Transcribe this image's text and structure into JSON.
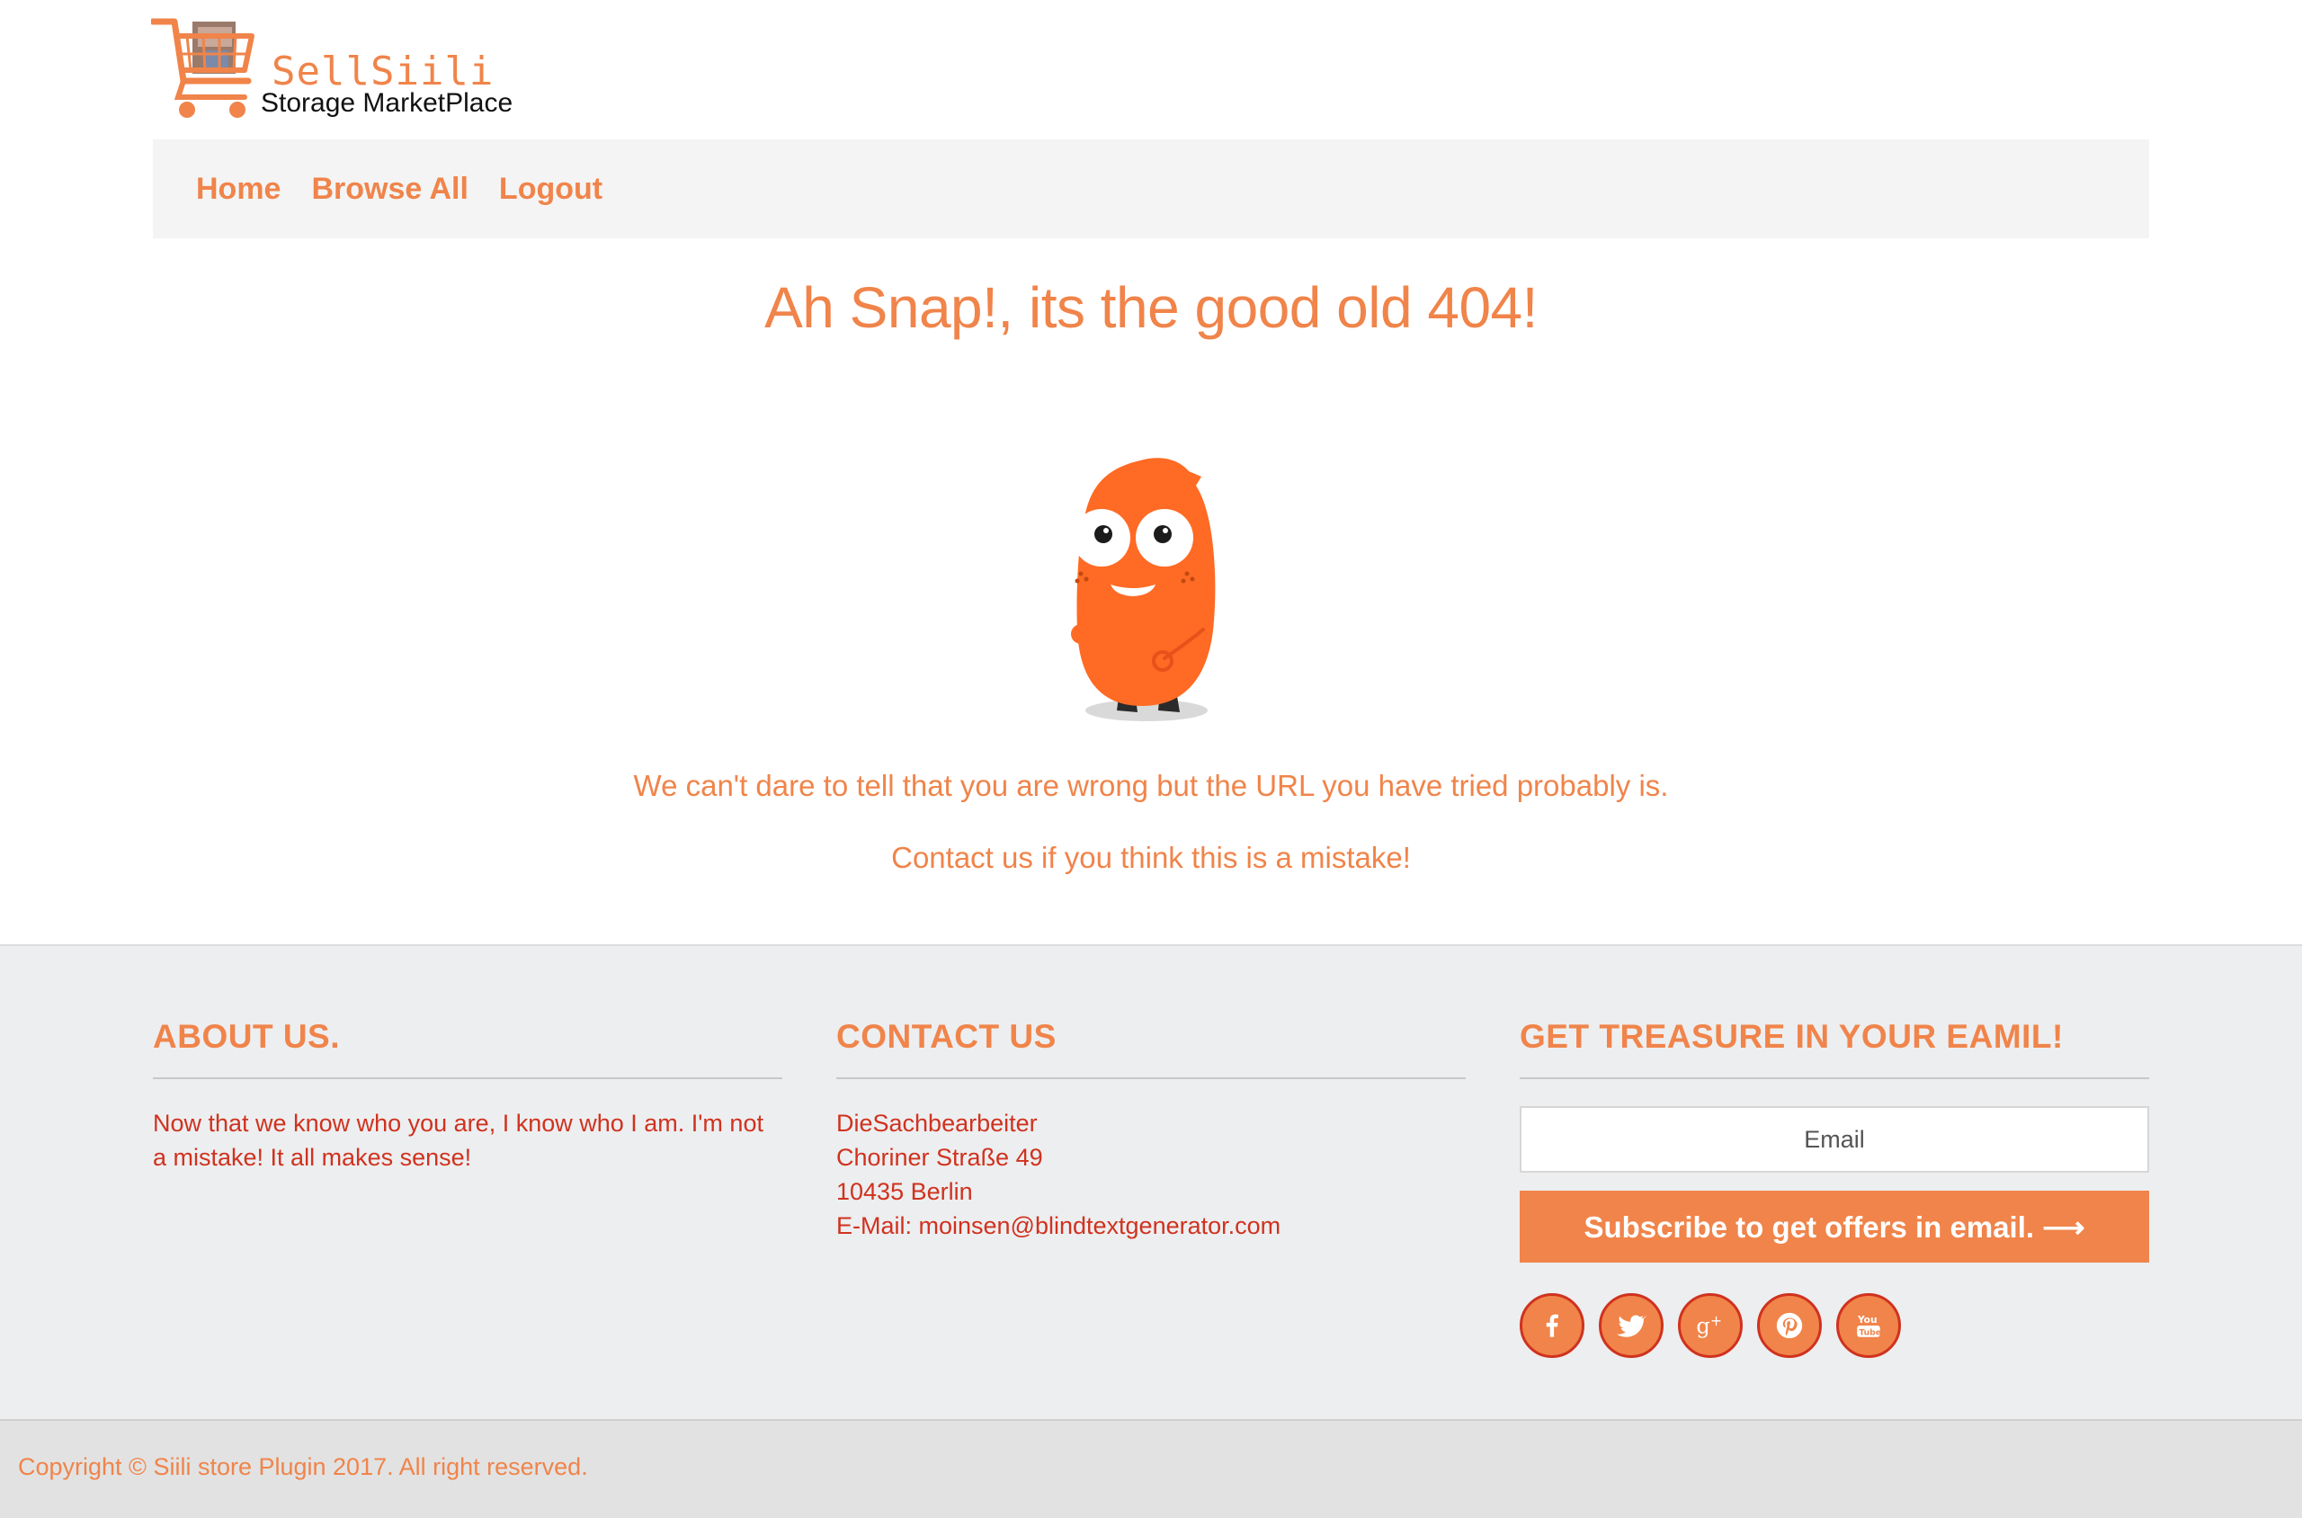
{
  "brand": {
    "name": "SellSiili",
    "tagline": "Storage MarketPlace",
    "logo_icon": "shopping-cart-icon"
  },
  "nav": {
    "items": [
      {
        "label": "Home"
      },
      {
        "label": "Browse All"
      },
      {
        "label": "Logout"
      }
    ]
  },
  "error": {
    "headline": "Ah Snap!, its the good old 404!",
    "illustration": "orange-monster-illustration",
    "message": "We can't dare to tell that you are wrong but the URL you have tried probably is.",
    "contact_message": "Contact us if you think this is a mistake!"
  },
  "footer": {
    "about": {
      "title": "ABOUT US.",
      "text": "Now that we know who you are, I know who I am. I'm not a mistake! It all makes sense!"
    },
    "contact": {
      "title": "CONTACT US",
      "lines": [
        "DieSachbearbeiter",
        "Choriner Straße 49",
        "10435 Berlin",
        "E-Mail: moinsen@blindtextgenerator.com"
      ]
    },
    "newsletter": {
      "title": "GET TREASURE IN YOUR EAMIL!",
      "email_placeholder": "Email",
      "email_value": "",
      "subscribe_label": "Subscribe to get offers in email. ⟶"
    },
    "socials": [
      "facebook-icon",
      "twitter-icon",
      "google-plus-icon",
      "pinterest-icon",
      "youtube-icon"
    ]
  },
  "copyright": "Copyright © Siili store Plugin 2017. All right reserved.",
  "colors": {
    "accent": "#f0844a",
    "text_red": "#d0321e",
    "footer_bg": "#edeef0",
    "nav_bg": "#f4f4f4",
    "monster": "#ff6a24"
  }
}
